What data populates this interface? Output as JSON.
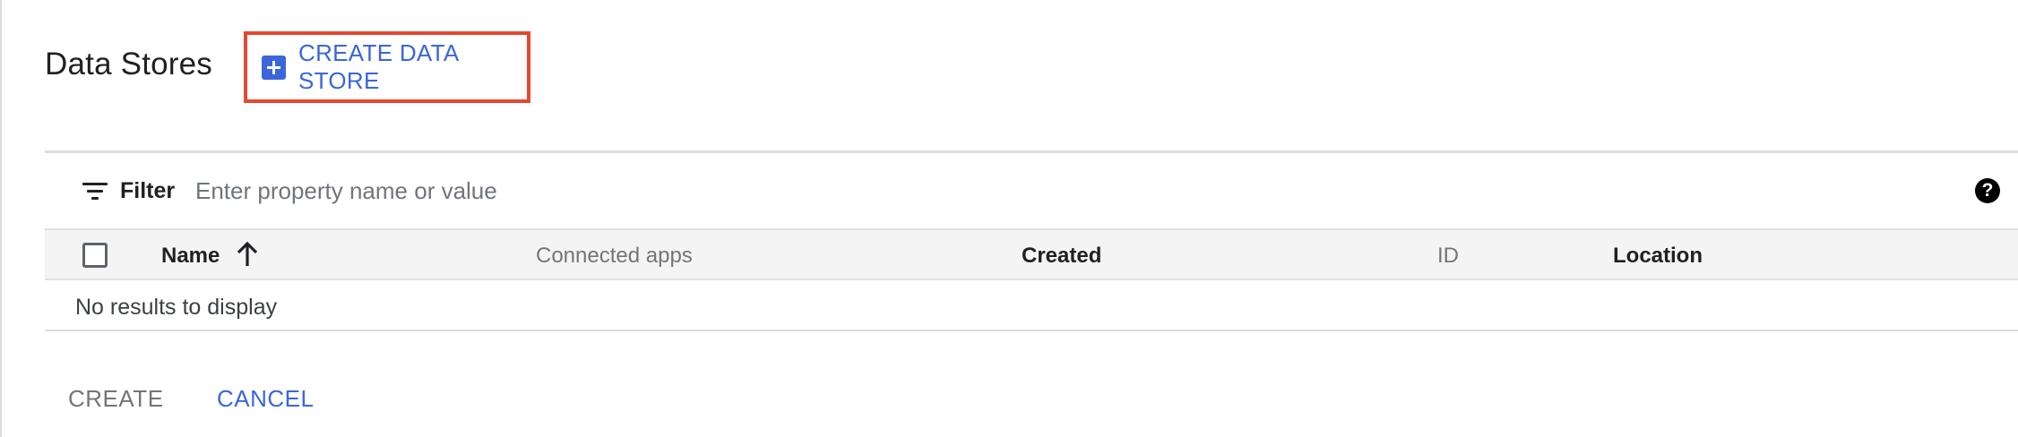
{
  "header": {
    "title": "Data Stores",
    "create_data_store_label": "CREATE DATA STORE"
  },
  "filter": {
    "label": "Filter",
    "placeholder": "Enter property name or value"
  },
  "table": {
    "columns": [
      {
        "label": "Name",
        "sort": "ascending"
      },
      {
        "label": "Connected apps"
      },
      {
        "label": "Created"
      },
      {
        "label": "ID"
      },
      {
        "label": "Location"
      }
    ],
    "empty_message": "No results to display"
  },
  "actions": {
    "create_label": "CREATE",
    "cancel_label": "CANCEL"
  },
  "colors": {
    "accent": "#3b66d9",
    "highlight_border": "#e8472f"
  }
}
